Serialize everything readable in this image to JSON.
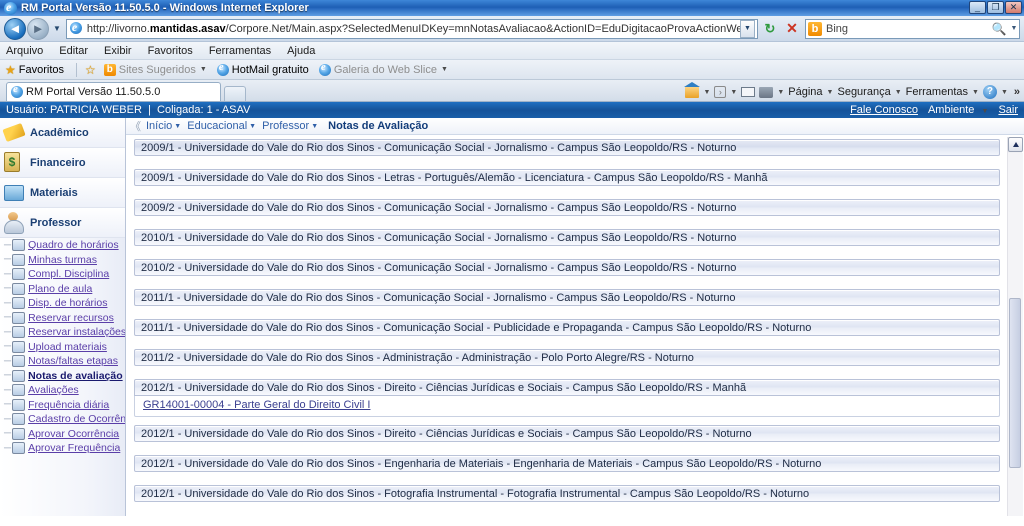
{
  "window": {
    "title": "RM Portal Versão 11.50.5.0 - Windows Internet Explorer",
    "app_icon": "ie-logo-icon",
    "minimize_label": "_",
    "restore_label": "❐",
    "close_label": "✕"
  },
  "nav": {
    "back_label": "◄",
    "forward_label": "►",
    "history_dropdown_label": "▼",
    "url_prefix": "http://livorno.",
    "url_bold": "mantidas.asav",
    "url_suffix": "/Corpore.Net/Main.aspx?SelectedMenuIDKey=mnNotasAvaliacao&ActionID=EduDigitacaoProvaActionWeb",
    "url_full": "http://livorno.mantidas.asav/Corpore.Net/Main.aspx?SelectedMenuIDKey=mnNotasAvaliacao&ActionID=EduDigitacaoProvaActionWeb",
    "url_dropdown_label": "▼",
    "refresh_label": "↻",
    "stop_label": "✕",
    "search_provider": "Bing",
    "search_provider_initial": "b",
    "search_go_label": "🔍",
    "search_dropdown_label": "▼"
  },
  "menubar": {
    "items": [
      "Arquivo",
      "Editar",
      "Exibir",
      "Favoritos",
      "Ferramentas",
      "Ajuda"
    ]
  },
  "favbar": {
    "favorites_label": "Favoritos",
    "items": [
      {
        "label": "Sites Sugeridos",
        "dim": true,
        "caret": "▼",
        "icon": "bing-orange-icon"
      },
      {
        "label": "HotMail gratuito",
        "dim": false,
        "caret": "",
        "icon": "ie-small-icon"
      },
      {
        "label": "Galeria do Web Slice",
        "dim": true,
        "caret": "▼",
        "icon": "ie-small-icon"
      }
    ]
  },
  "tabs": {
    "active": "RM Portal Versão 11.50.5.0",
    "new_tab_label": ""
  },
  "commandbar": {
    "items": [
      {
        "label": "Página",
        "caret": "▼"
      },
      {
        "label": "Segurança",
        "caret": "▼"
      },
      {
        "label": "Ferramentas",
        "caret": "▼"
      }
    ],
    "overflow_label": "»",
    "home_caret": "▼",
    "feed_caret": "▼",
    "print_caret": "▼",
    "help_caret": "▼"
  },
  "appbar": {
    "user_prefix": "Usuário:",
    "user_name": "PATRICIA WEBER",
    "separator": "|",
    "coligada_label": "Coligada: 1 - ASAV",
    "fale_conosco": "Fale Conosco",
    "ambiente": "Ambiente",
    "ambiente_caret": "▼",
    "sair": "Sair"
  },
  "breadcrumb": {
    "collapse_label": "《",
    "items": [
      {
        "label": "Início",
        "caret": "▼",
        "current": false
      },
      {
        "label": "Educacional",
        "caret": "▼",
        "current": false
      },
      {
        "label": "Professor",
        "caret": "▼",
        "current": false
      }
    ],
    "current": "Notas de Avaliação"
  },
  "sidebar": {
    "groups": [
      {
        "label": "Acadêmico",
        "icon": "academic-icon"
      },
      {
        "label": "Financeiro",
        "icon": "finance-icon"
      },
      {
        "label": "Materiais",
        "icon": "materials-icon"
      }
    ],
    "professor": {
      "label": "Professor",
      "icon": "professor-icon"
    },
    "items": [
      {
        "label": "Quadro de horários",
        "icon": "clock-icon",
        "active": false
      },
      {
        "label": "Minhas turmas",
        "icon": "class-icon",
        "active": false
      },
      {
        "label": "Compl. Disciplina",
        "icon": "book-icon",
        "active": false
      },
      {
        "label": "Plano de aula",
        "icon": "plan-icon",
        "active": false
      },
      {
        "label": "Disp. de horários",
        "icon": "calendar-icon",
        "active": false
      },
      {
        "label": "Reservar recursos",
        "icon": "check-icon",
        "active": false
      },
      {
        "label": "Reservar instalações",
        "icon": "building-icon",
        "active": false
      },
      {
        "label": "Upload materiais",
        "icon": "upload-icon",
        "active": false
      },
      {
        "label": "Notas/faltas etapas",
        "icon": "grid-icon",
        "active": false
      },
      {
        "label": "Notas de avaliação",
        "icon": "pencil-icon",
        "active": true
      },
      {
        "label": "Avaliações",
        "icon": "exam-icon",
        "active": false
      },
      {
        "label": "Frequência diária",
        "icon": "attendance-icon",
        "active": false
      },
      {
        "label": "Cadastro de Ocorrência",
        "icon": "record-icon",
        "active": false
      },
      {
        "label": "Aprovar Ocorrência",
        "icon": "approve-icon",
        "active": false
      },
      {
        "label": "Aprovar Frequência",
        "icon": "approve-freq-icon",
        "active": false
      }
    ]
  },
  "list": {
    "rows": [
      {
        "text": "2009/1 - Universidade do Vale do Rio dos Sinos - Comunicação Social - Jornalismo - Campus São Leopoldo/RS - Noturno",
        "expanded": false,
        "first": true
      },
      {
        "text": "2009/1 - Universidade do Vale do Rio dos Sinos - Letras - Português/Alemão - Licenciatura - Campus São Leopoldo/RS - Manhã",
        "expanded": false,
        "first": false
      },
      {
        "text": "2009/2 - Universidade do Vale do Rio dos Sinos - Comunicação Social - Jornalismo - Campus São Leopoldo/RS - Noturno",
        "expanded": false,
        "first": false
      },
      {
        "text": "2010/1 - Universidade do Vale do Rio dos Sinos - Comunicação Social - Jornalismo - Campus São Leopoldo/RS - Noturno",
        "expanded": false,
        "first": false
      },
      {
        "text": "2010/2 - Universidade do Vale do Rio dos Sinos - Comunicação Social - Jornalismo - Campus São Leopoldo/RS - Noturno",
        "expanded": false,
        "first": false
      },
      {
        "text": "2011/1 - Universidade do Vale do Rio dos Sinos - Comunicação Social - Jornalismo - Campus São Leopoldo/RS - Noturno",
        "expanded": false,
        "first": false
      },
      {
        "text": "2011/1 - Universidade do Vale do Rio dos Sinos - Comunicação Social - Publicidade e Propaganda - Campus São Leopoldo/RS - Noturno",
        "expanded": false,
        "first": false
      },
      {
        "text": "2011/2 - Universidade do Vale do Rio dos Sinos - Administração - Administração - Polo Porto Alegre/RS - Noturno",
        "expanded": false,
        "first": false
      },
      {
        "text": "2012/1 - Universidade do Vale do Rio dos Sinos - Direito - Ciências Jurídicas e Sociais - Campus São Leopoldo/RS - Manhã",
        "expanded": true,
        "first": false,
        "child": "GR14001-00004 - Parte Geral do Direito Civil I"
      },
      {
        "text": "2012/1 - Universidade do Vale do Rio dos Sinos - Direito - Ciências Jurídicas e Sociais - Campus São Leopoldo/RS - Noturno",
        "expanded": false,
        "first": false
      },
      {
        "text": "2012/1 - Universidade do Vale do Rio dos Sinos - Engenharia de Materiais - Engenharia de Materiais - Campus São Leopoldo/RS - Noturno",
        "expanded": false,
        "first": false
      },
      {
        "text": "2012/1 - Universidade do Vale do Rio dos Sinos - Fotografia Instrumental - Fotografia Instrumental - Campus São Leopoldo/RS - Noturno",
        "expanded": false,
        "first": false
      }
    ],
    "scroll_up_label": "▲"
  },
  "colors": {
    "accent_blue": "#15539a",
    "link_purple": "#5a3ea8",
    "row_border": "#b9c2d8",
    "titlebar_blue": "#1e5fb5"
  }
}
